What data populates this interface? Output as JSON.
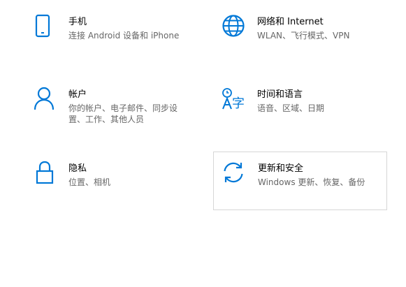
{
  "accent_color": "#0078d7",
  "tiles": {
    "phone": {
      "icon": "phone-icon",
      "title": "手机",
      "desc_line1": "连接 Android 设备和 iPhone"
    },
    "network": {
      "icon": "globe-icon",
      "title": "网络和 Internet",
      "desc_line1": "WLAN、飞行模式、VPN"
    },
    "accounts": {
      "icon": "person-icon",
      "title": "帐户",
      "desc_line1": "你的帐户、电子邮件、同步设",
      "desc_line2": "置、工作、其他人员"
    },
    "time_language": {
      "icon": "time-language-icon",
      "title": "时间和语言",
      "desc_line1": "语音、区域、日期"
    },
    "privacy": {
      "icon": "lock-icon",
      "title": "隐私",
      "desc_line1": "位置、相机"
    },
    "update_security": {
      "icon": "sync-icon",
      "title": "更新和安全",
      "desc_line1": "Windows 更新、恢复、备份"
    }
  }
}
